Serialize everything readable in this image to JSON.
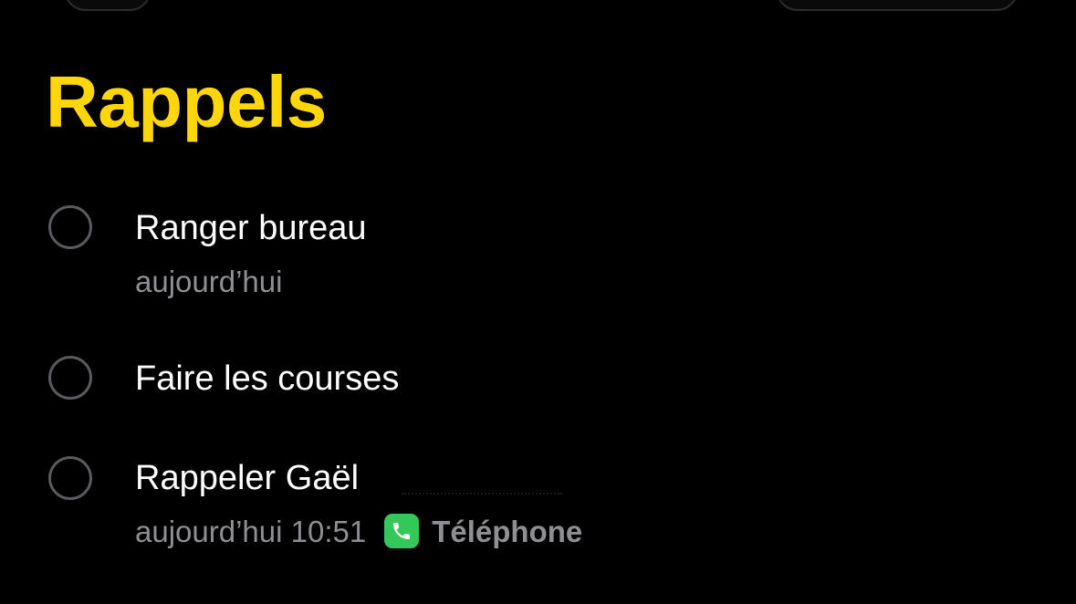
{
  "header": {
    "title": "Rappels"
  },
  "reminders": [
    {
      "title": "Ranger bureau",
      "subtitle": "aujourd’hui"
    },
    {
      "title": "Faire les courses"
    },
    {
      "title": "Rappeler Gaël",
      "subtitle": "aujourd’hui 10:51",
      "action_label": "Téléphone",
      "action_icon": "phone-icon"
    }
  ],
  "colors": {
    "title": "#FFD60A",
    "text": "#FFFFFF",
    "secondary": "#8E8E93",
    "circle": "#5A5A5E",
    "phone_green": "#34C759"
  }
}
